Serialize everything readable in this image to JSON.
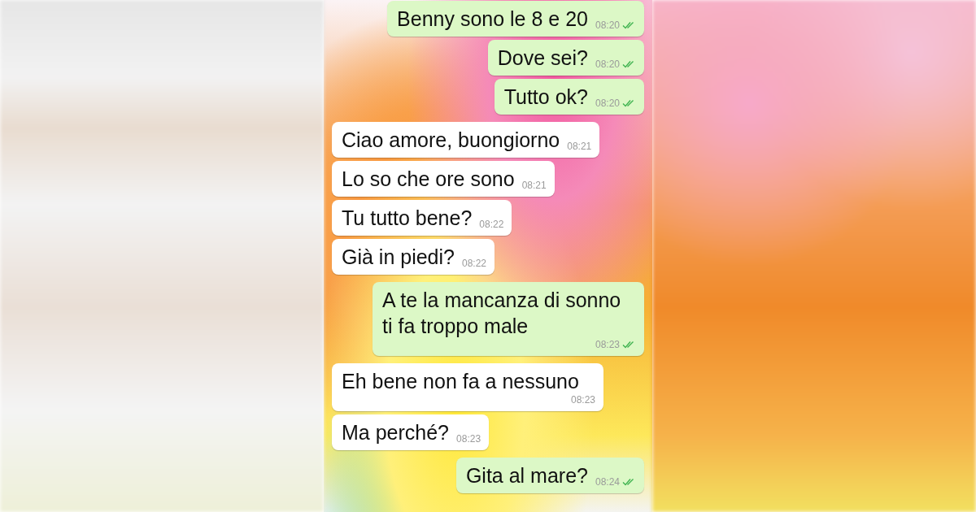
{
  "messages": [
    {
      "kind": "sent",
      "text": "Benny sono le 8 e 20",
      "time": "08:20",
      "read": true
    },
    {
      "kind": "sent",
      "text": "Dove sei?",
      "time": "08:20",
      "read": true
    },
    {
      "kind": "sent",
      "text": "Tutto ok?",
      "time": "08:20",
      "read": true
    },
    {
      "kind": "received",
      "text": "Ciao amore, buongiorno",
      "time": "08:21"
    },
    {
      "kind": "received",
      "text": "Lo so che ore sono",
      "time": "08:21"
    },
    {
      "kind": "received",
      "text": "Tu tutto bene?",
      "time": "08:22"
    },
    {
      "kind": "received",
      "text": "Già in piedi?",
      "time": "08:22"
    },
    {
      "kind": "sent",
      "text": "A te la mancanza di sonno ti fa troppo male",
      "time": "08:23",
      "read": true
    },
    {
      "kind": "received",
      "text": "Eh bene non fa a nessuno",
      "time": "08:23"
    },
    {
      "kind": "received",
      "text": "Ma perché?",
      "time": "08:23"
    },
    {
      "kind": "sent",
      "text": "Gita al mare?",
      "time": "08:24",
      "read": true
    }
  ]
}
